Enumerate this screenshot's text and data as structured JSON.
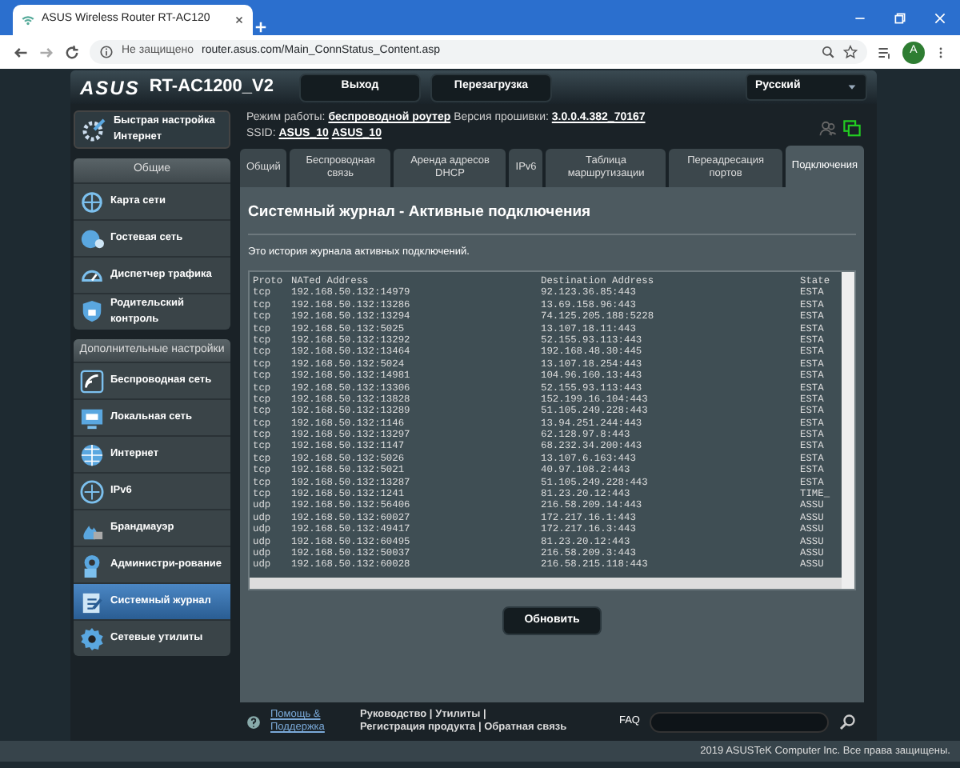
{
  "browser": {
    "tab_title": "ASUS Wireless Router RT-AC120",
    "security": "Не защищено",
    "url": "router.asus.com/Main_ConnStatus_Content.asp",
    "avatar": "A"
  },
  "header": {
    "logo": "ASUS",
    "model": "RT-AC1200_V2",
    "buttons": [
      "Выход",
      "Перезагрузка"
    ],
    "language": "Русский"
  },
  "info": {
    "mode_label": "Режим работы:",
    "mode": "беспроводной роутер",
    "fw_label": "Версия прошивки:",
    "fw": "3.0.0.4.382_70167",
    "ssid_label": "SSID:",
    "ssids": [
      "ASUS_10",
      "ASUS_10"
    ]
  },
  "sidebar": {
    "quick_setup": "Быстрая настройка Интернет",
    "sections": [
      {
        "title": "Общие",
        "items": [
          {
            "label": "Карта сети",
            "selected": false
          },
          {
            "label": "Гостевая сеть",
            "selected": false
          },
          {
            "label": "Диспетчер трафика",
            "selected": false
          },
          {
            "label": "Родительский контроль",
            "selected": false
          }
        ]
      },
      {
        "title": "Дополнительные настройки",
        "items": [
          {
            "label": "Беспроводная сеть",
            "selected": false
          },
          {
            "label": "Локальная сеть",
            "selected": false
          },
          {
            "label": "Интернет",
            "selected": false
          },
          {
            "label": "IPv6",
            "selected": false
          },
          {
            "label": "Брандмауэр",
            "selected": false
          },
          {
            "label": "Администри-рование",
            "selected": false
          },
          {
            "label": "Системный журнал",
            "selected": true
          },
          {
            "label": "Сетевые утилиты",
            "selected": false
          }
        ]
      }
    ]
  },
  "tabs": [
    {
      "label": "Общий",
      "selected": false
    },
    {
      "label": "Беспроводная связь",
      "selected": false
    },
    {
      "label": "Аренда адресов DHCP",
      "selected": false
    },
    {
      "label": "IPv6",
      "selected": false
    },
    {
      "label": "Таблица маршрутизации",
      "selected": false
    },
    {
      "label": "Переадресация портов",
      "selected": false
    },
    {
      "label": "Подключения",
      "selected": true
    }
  ],
  "panel": {
    "title": "Системный журнал - Активные подключения",
    "description": "Это история журнала активных подключений.",
    "log": {
      "columns": [
        "Proto",
        "NATed Address",
        "Destination Address",
        "State"
      ],
      "rows": [
        [
          "tcp",
          "192.168.50.132:14979",
          "92.123.36.85:443",
          "ESTA"
        ],
        [
          "tcp",
          "192.168.50.132:13286",
          "13.69.158.96:443",
          "ESTA"
        ],
        [
          "tcp",
          "192.168.50.132:13294",
          "74.125.205.188:5228",
          "ESTA"
        ],
        [
          "tcp",
          "192.168.50.132:5025",
          "13.107.18.11:443",
          "ESTA"
        ],
        [
          "tcp",
          "192.168.50.132:13292",
          "52.155.93.113:443",
          "ESTA"
        ],
        [
          "tcp",
          "192.168.50.132:13464",
          "192.168.48.30:445",
          "ESTA"
        ],
        [
          "tcp",
          "192.168.50.132:5024",
          "13.107.18.254:443",
          "ESTA"
        ],
        [
          "tcp",
          "192.168.50.132:14981",
          "104.96.160.13:443",
          "ESTA"
        ],
        [
          "tcp",
          "192.168.50.132:13306",
          "52.155.93.113:443",
          "ESTA"
        ],
        [
          "tcp",
          "192.168.50.132:13828",
          "152.199.16.104:443",
          "ESTA"
        ],
        [
          "tcp",
          "192.168.50.132:13289",
          "51.105.249.228:443",
          "ESTA"
        ],
        [
          "tcp",
          "192.168.50.132:1146",
          "13.94.251.244:443",
          "ESTA"
        ],
        [
          "tcp",
          "192.168.50.132:13297",
          "62.128.97.8:443",
          "ESTA"
        ],
        [
          "tcp",
          "192.168.50.132:1147",
          "68.232.34.200:443",
          "ESTA"
        ],
        [
          "tcp",
          "192.168.50.132:5026",
          "13.107.6.163:443",
          "ESTA"
        ],
        [
          "tcp",
          "192.168.50.132:5021",
          "40.97.108.2:443",
          "ESTA"
        ],
        [
          "tcp",
          "192.168.50.132:13287",
          "51.105.249.228:443",
          "ESTA"
        ],
        [
          "tcp",
          "192.168.50.132:1241",
          "81.23.20.12:443",
          "TIME_"
        ],
        [
          "udp",
          "192.168.50.132:56406",
          "216.58.209.14:443",
          "ASSU"
        ],
        [
          "udp",
          "192.168.50.132:60027",
          "172.217.16.1:443",
          "ASSU"
        ],
        [
          "udp",
          "192.168.50.132:49417",
          "172.217.16.3:443",
          "ASSU"
        ],
        [
          "udp",
          "192.168.50.132:60495",
          "81.23.20.12:443",
          "ASSU"
        ],
        [
          "udp",
          "192.168.50.132:50037",
          "216.58.209.3:443",
          "ASSU"
        ],
        [
          "udp",
          "192.168.50.132:60028",
          "216.58.215.118:443",
          "ASSU"
        ]
      ]
    },
    "refresh_button": "Обновить"
  },
  "footer": {
    "help": "Помощь & Поддержка",
    "links": [
      "Руководство",
      "Утилиты",
      "Регистрация продукта",
      "Обратная связь"
    ],
    "separator": "|",
    "faq": "FAQ",
    "copyright": "2019 ASUSTeK Computer Inc. Все права защищены."
  }
}
